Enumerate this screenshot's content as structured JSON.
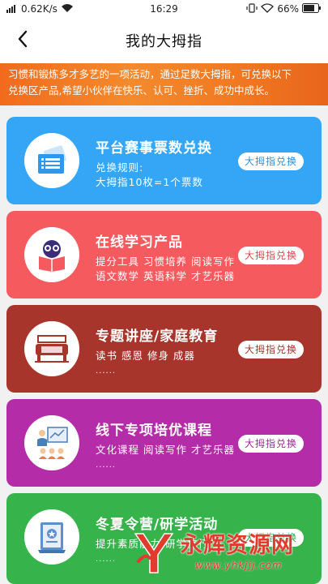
{
  "status_bar": {
    "network_speed": "0.62K/s",
    "time": "16:29",
    "battery": "66%"
  },
  "nav": {
    "title": "我的大拇指"
  },
  "banner": {
    "line1": "习惯和锻炼多才多艺的一项活动，通过足数大拇指，可兑换以下",
    "line2": "兑换区产品,希望小伙伴在快乐、认可、挫折、成功中成长。"
  },
  "cards": [
    {
      "title": "平台赛事票数兑换",
      "line1": "兑换规则:",
      "line2": "大拇指10枚=1个票数",
      "button": "大拇指兑换",
      "icon": "ticket-icon",
      "color": "#34a6f5"
    },
    {
      "title": "在线学习产品",
      "line1": "提分工具  习惯培养  阅读写作",
      "line2": "语文数学  英语科学  才艺乐器",
      "button": "大拇指兑换",
      "icon": "owl-book-icon",
      "color": "#f55a5f"
    },
    {
      "title": "专题讲座/家庭教育",
      "line1": "读书   感恩   修身   成器",
      "dots": "......",
      "button": "大拇指兑换",
      "icon": "sofa-icon",
      "color": "#a7352c"
    },
    {
      "title": "线下专项培优课程",
      "line1": "文化课程  阅读写作  才艺乐器",
      "dots": "......",
      "button": "大拇指兑换",
      "icon": "classroom-icon",
      "color": "#b52ca9"
    },
    {
      "title": "冬夏令营/研学活动",
      "line1": "提升素质能力  研学旅行",
      "dots": "......",
      "button": "大拇指兑换",
      "icon": "certificate-icon",
      "color": "#37b34b"
    }
  ],
  "watermark": {
    "text": "永辉资源网",
    "url": "www.yhkjjj.com"
  }
}
